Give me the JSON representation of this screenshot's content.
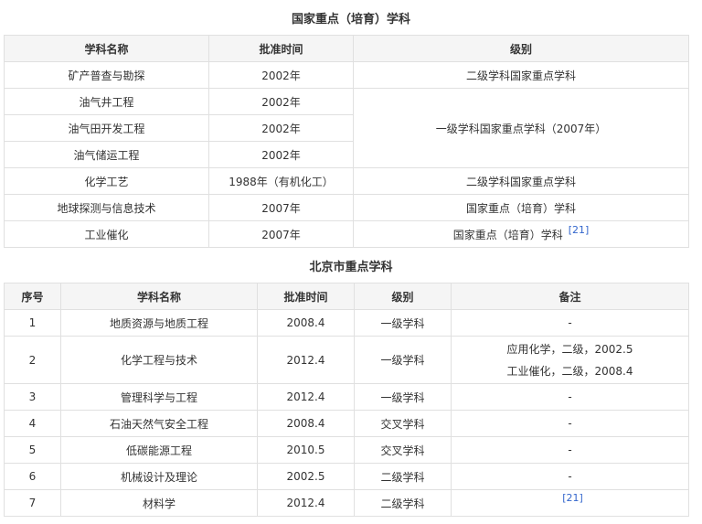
{
  "table1": {
    "title": "国家重点（培育）学科",
    "headers": [
      "学科名称",
      "批准时间",
      "级别"
    ],
    "rows": [
      {
        "name": "矿产普查与勘探",
        "time": "2002年",
        "level": "二级学科国家重点学科"
      },
      {
        "name": "油气井工程",
        "time": "2002年"
      },
      {
        "name": "油气田开发工程",
        "time": "2002年"
      },
      {
        "name": "油气储运工程",
        "time": "2002年"
      },
      {
        "name": "化学工艺",
        "time": "1988年（有机化工）",
        "level": "二级学科国家重点学科"
      },
      {
        "name": "地球探测与信息技术",
        "time": "2007年",
        "level": "国家重点（培育）学科"
      },
      {
        "name": "工业催化",
        "time": "2007年",
        "level": "国家重点（培育）学科",
        "ref": "[21]"
      }
    ],
    "merged_level": "一级学科国家重点学科（2007年）"
  },
  "table2": {
    "title": "北京市重点学科",
    "headers": [
      "序号",
      "学科名称",
      "批准时间",
      "级别",
      "备注"
    ],
    "rows": [
      {
        "no": "1",
        "name": "地质资源与地质工程",
        "time": "2008.4",
        "level": "一级学科",
        "note": "-"
      },
      {
        "no": "2",
        "name": "化学工程与技术",
        "time": "2012.4",
        "level": "一级学科",
        "note_lines": [
          "应用化学，二级，2002.5",
          "工业催化，二级，2008.4"
        ]
      },
      {
        "no": "3",
        "name": "管理科学与工程",
        "time": "2012.4",
        "level": "一级学科",
        "note": "-"
      },
      {
        "no": "4",
        "name": "石油天然气安全工程",
        "time": "2008.4",
        "level": "交叉学科",
        "note": "-"
      },
      {
        "no": "5",
        "name": "低碳能源工程",
        "time": "2010.5",
        "level": "交叉学科",
        "note": "-"
      },
      {
        "no": "6",
        "name": "机械设计及理论",
        "time": "2002.5",
        "level": "二级学科",
        "note": "-"
      },
      {
        "no": "7",
        "name": "材料学",
        "time": "2012.4",
        "level": "二级学科",
        "ref": "[21]"
      }
    ]
  }
}
